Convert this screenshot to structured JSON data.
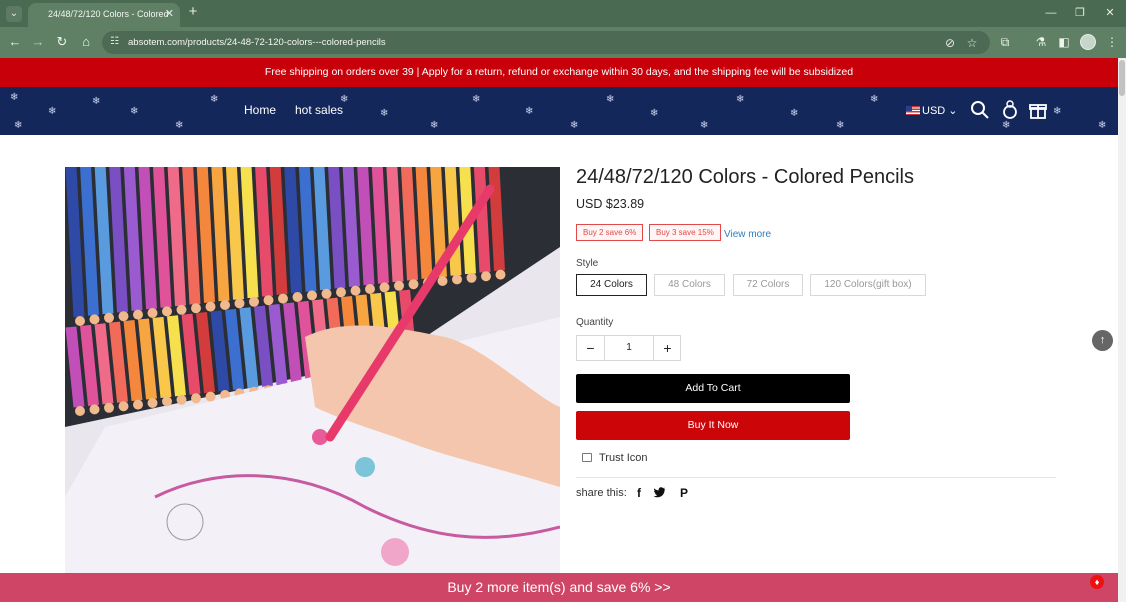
{
  "browser": {
    "tab_title": "24/48/72/120 Colors - Colored",
    "url": "absotem.com/products/24-48-72-120-colors---colored-pencils"
  },
  "announcement": "Free shipping on orders over 39 | Apply for a return, refund or exchange within 30 days, and the shipping fee will be subsidized",
  "header": {
    "nav": [
      "Home",
      "hot sales"
    ],
    "currency": "USD",
    "icons": [
      "search-icon",
      "account-icon",
      "gift-icon"
    ]
  },
  "product": {
    "title": "24/48/72/120 Colors - Colored Pencils",
    "price": "USD $23.89",
    "promos": [
      "Buy 2 save 6%",
      "Buy 3 save 15%"
    ],
    "view_more": "View more",
    "style_label": "Style",
    "styles": [
      "24 Colors",
      "48 Colors",
      "72 Colors",
      "120 Colors(gift box)"
    ],
    "selected_style": "24 Colors",
    "quantity_label": "Quantity",
    "quantity": "1",
    "add_to_cart": "Add To Cart",
    "buy_now": "Buy It Now",
    "trust_label": "Trust Icon",
    "share_label": "share this:",
    "share_icons": [
      "facebook-icon",
      "twitter-icon",
      "pinterest-icon"
    ]
  },
  "bottom_bar": "Buy 2 more item(s) and save 6%  >>",
  "colors": {
    "announce_bg": "#c8000a",
    "header_bg": "#14275a",
    "buy_now_bg": "#cc0509",
    "bottom_bar_bg": "#cf4565",
    "link": "#2e7cc0"
  },
  "pencil_colors": [
    "#2e4aa6",
    "#3b6fd0",
    "#5a9be0",
    "#7b4fc4",
    "#9a5ad0",
    "#c24fb8",
    "#e0529a",
    "#f06a8a",
    "#f26b5a",
    "#f5873c",
    "#f7a540",
    "#f9c84a",
    "#f6e04e",
    "#e84b6a",
    "#d23c3c"
  ]
}
